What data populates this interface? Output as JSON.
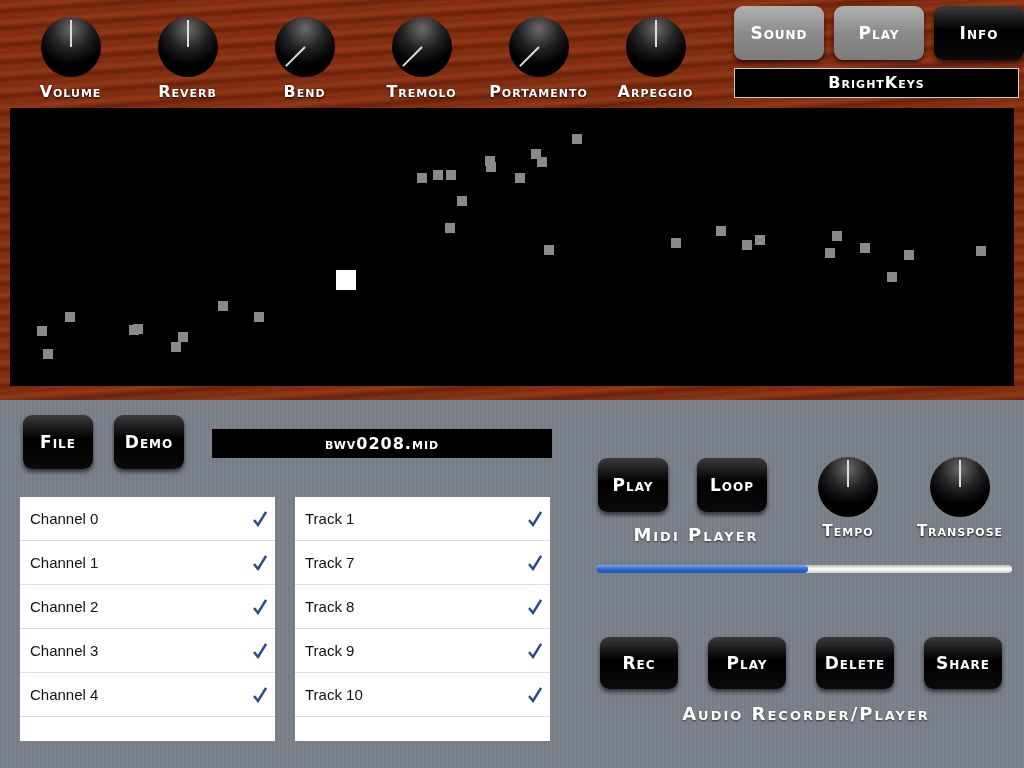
{
  "knobs": [
    {
      "label": "Volume"
    },
    {
      "label": "Reverb"
    },
    {
      "label": "Bend"
    },
    {
      "label": "Tremolo"
    },
    {
      "label": "Portamento"
    },
    {
      "label": "Arpeggio"
    }
  ],
  "mode_buttons": [
    {
      "label": "Sound",
      "selected": false
    },
    {
      "label": "Play",
      "selected": false
    },
    {
      "label": "Info",
      "selected": true
    }
  ],
  "sound_name": "BrightKeys",
  "file_buttons": [
    "File",
    "Demo"
  ],
  "file_name": "bwv0208.mid",
  "channels": [
    {
      "label": "Channel 0",
      "checked": true
    },
    {
      "label": "Channel 1",
      "checked": true
    },
    {
      "label": "Channel 2",
      "checked": true
    },
    {
      "label": "Channel 3",
      "checked": true
    },
    {
      "label": "Channel 4",
      "checked": true
    }
  ],
  "tracks": [
    {
      "label": "Track 1",
      "checked": true
    },
    {
      "label": "Track 7",
      "checked": true
    },
    {
      "label": "Track 8",
      "checked": true
    },
    {
      "label": "Track 9",
      "checked": true
    },
    {
      "label": "Track 10",
      "checked": true
    }
  ],
  "midi_player": {
    "buttons": [
      "Play",
      "Loop"
    ],
    "title": "Midi Player",
    "knobs": [
      {
        "label": "Tempo"
      },
      {
        "label": "Transpose"
      }
    ],
    "progress": {
      "level": 0.51
    }
  },
  "audio_recorder": {
    "buttons": [
      "Rec",
      "Play",
      "Delete",
      "Share"
    ],
    "title": "Audio Recorder/Player"
  }
}
